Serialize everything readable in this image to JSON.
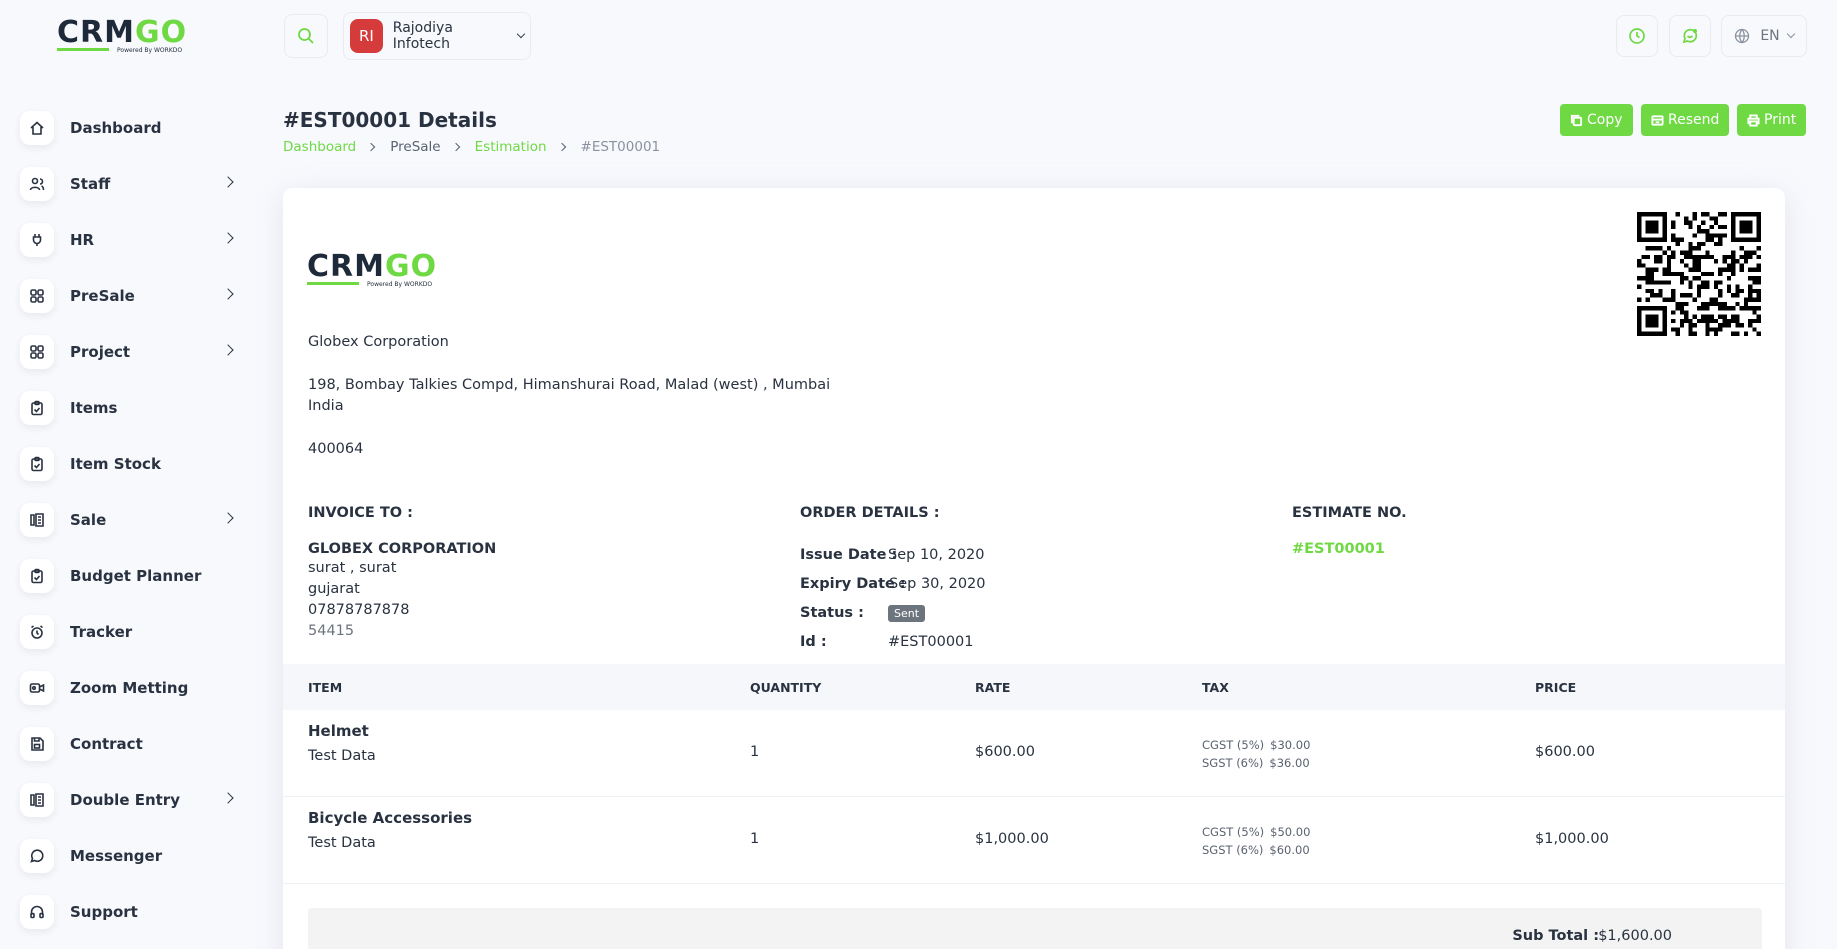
{
  "brand": {
    "logo_text": "CRMGO",
    "logo_tagline": "Powered By WORKDO",
    "accent": "#6fd943"
  },
  "sidebar": {
    "items": [
      {
        "label": "Dashboard",
        "icon": "home-icon",
        "has_submenu": false
      },
      {
        "label": "Staff",
        "icon": "users-icon",
        "has_submenu": true
      },
      {
        "label": "HR",
        "icon": "plug-icon",
        "has_submenu": true
      },
      {
        "label": "PreSale",
        "icon": "grid-icon",
        "has_submenu": true
      },
      {
        "label": "Project",
        "icon": "grid-icon",
        "has_submenu": true
      },
      {
        "label": "Items",
        "icon": "clipboard-check-icon",
        "has_submenu": false
      },
      {
        "label": "Item Stock",
        "icon": "clipboard-check-icon",
        "has_submenu": false
      },
      {
        "label": "Sale",
        "icon": "receipt-icon",
        "has_submenu": true
      },
      {
        "label": "Budget Planner",
        "icon": "clipboard-check-icon",
        "has_submenu": false
      },
      {
        "label": "Tracker",
        "icon": "alarm-clock-icon",
        "has_submenu": false
      },
      {
        "label": "Zoom Metting",
        "icon": "video-icon",
        "has_submenu": false
      },
      {
        "label": "Contract",
        "icon": "device-floppy-icon",
        "has_submenu": false
      },
      {
        "label": "Double Entry",
        "icon": "receipt-icon",
        "has_submenu": true
      },
      {
        "label": "Messenger",
        "icon": "message-icon",
        "has_submenu": false
      },
      {
        "label": "Support",
        "icon": "headphones-icon",
        "has_submenu": false
      }
    ]
  },
  "header": {
    "company_initials": "RI",
    "company_name": "Rajodiya Infotech",
    "language": "EN"
  },
  "page": {
    "title": "#EST00001 Details",
    "breadcrumb": [
      "Dashboard",
      "PreSale",
      "Estimation",
      "#EST00001"
    ],
    "actions": {
      "copy": "Copy",
      "resend": "Resend",
      "print": "Print"
    }
  },
  "invoice": {
    "company_name": "Globex Corporation",
    "address_line1": "198, Bombay Talkies Compd, Himanshurai Road, Malad (west) , Mumbai",
    "address_line2": "India",
    "zip": "400064",
    "invoice_to_heading": "INVOICE TO :",
    "order_details_heading": "ORDER DETAILS :",
    "estimate_no_heading": "ESTIMATE NO.",
    "bill_to": {
      "name": "GLOBEX CORPORATION",
      "city": "surat , surat",
      "state": "gujarat",
      "phone": "07878787878",
      "zip": "54415"
    },
    "order": {
      "issue_label": "Issue Date :",
      "issue_date": "Sep 10, 2020",
      "expiry_label": "Expiry Date :",
      "expiry_date": "Sep 30, 2020",
      "status_label": "Status :",
      "status": "Sent",
      "id_label": "Id :",
      "id": "#EST00001"
    },
    "estimate_no": "#EST00001",
    "columns": [
      "ITEM",
      "QUANTITY",
      "RATE",
      "TAX",
      "PRICE"
    ],
    "rows": [
      {
        "name": "Helmet",
        "desc": "Test Data",
        "qty": "1",
        "rate": "$600.00",
        "tax1_label": "CGST (5%)",
        "tax1_val": "$30.00",
        "tax2_label": "SGST (6%)",
        "tax2_val": "$36.00",
        "price": "$600.00"
      },
      {
        "name": "Bicycle Accessories",
        "desc": "Test Data",
        "qty": "1",
        "rate": "$1,000.00",
        "tax1_label": "CGST (5%)",
        "tax1_val": "$50.00",
        "tax2_label": "SGST (6%)",
        "tax2_val": "$60.00",
        "price": "$1,000.00"
      }
    ],
    "subtotal_label": "Sub Total :",
    "subtotal": "$1,600.00"
  }
}
